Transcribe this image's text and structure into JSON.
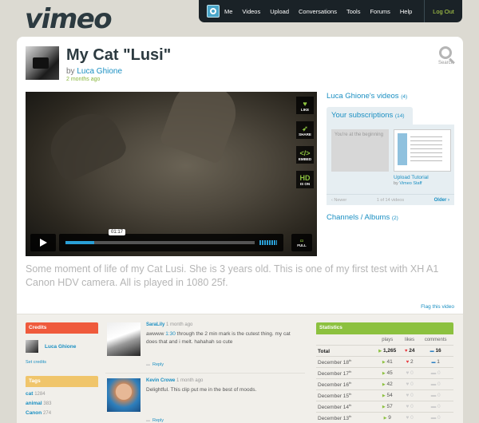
{
  "brand": "vimeo",
  "nav": {
    "items": [
      "Me",
      "Videos",
      "Upload",
      "Conversations",
      "Tools",
      "Forums",
      "Help"
    ],
    "logout": "Log Out"
  },
  "search": {
    "label": "Search"
  },
  "video": {
    "title": "My Cat \"Lusi\"",
    "by": "by",
    "author": "Luca Ghione",
    "posted": "2 months ago",
    "time": "01:17",
    "progress_fraction": 0.15,
    "buttons": {
      "like": "LIKE",
      "share": "SHARE",
      "embed": "EMBED",
      "hd": "HD",
      "hd_sub": "IS ON",
      "full": "FULL"
    },
    "description": "Some moment of life of my Cat Lusi. She is 3 years old. This is one of my first test with XH A1 Canon HDV camera. All is played in 1080 25f.",
    "flag": "Flag this video"
  },
  "sidebar": {
    "author_videos": "Luca Ghione's videos",
    "author_videos_count": "(4)",
    "subs": "Your subscriptions",
    "subs_count": "(14)",
    "sub_first": "You're at the beginning",
    "sub_title": "Upload Tutorial",
    "sub_by": "by",
    "sub_staff": "Vimeo Staff",
    "newer": "‹ Newer",
    "pager": "1 of 14 videos",
    "older": "Older ›",
    "channels": "Channels / Albums",
    "channels_count": "(2)"
  },
  "credits": {
    "header": "Credits",
    "name": "Luca Ghione",
    "set": "Set credits"
  },
  "tags": {
    "header": "Tags",
    "items": [
      {
        "name": "cat",
        "count": "1284"
      },
      {
        "name": "animal",
        "count": "383"
      },
      {
        "name": "Canon",
        "count": "274"
      }
    ]
  },
  "comments": [
    {
      "user": "SaraLily",
      "ago": "1 month ago",
      "text_a": "awwww ",
      "link": "1:30",
      "text_b": " through the 2 min mark is the cutest thing. my cat does that and i melt. hahahah so cute",
      "reply": "Reply"
    },
    {
      "user": "Kevin Crowe",
      "ago": "1 month ago",
      "text_a": "Delightful. This clip put me in the best of moods.",
      "link": "",
      "text_b": "",
      "reply": "Reply"
    }
  ],
  "stats": {
    "header": "Statistics",
    "cols": [
      "plays",
      "likes",
      "comments"
    ],
    "rows": [
      {
        "label": "Total",
        "sup": "",
        "plays": "1,265",
        "likes": "24",
        "comments": "16"
      },
      {
        "label": "December 18",
        "sup": "th",
        "plays": "41",
        "likes": "2",
        "comments": "1"
      },
      {
        "label": "December 17",
        "sup": "th",
        "plays": "45",
        "likes": "0",
        "comments": "0"
      },
      {
        "label": "December 16",
        "sup": "th",
        "plays": "42",
        "likes": "0",
        "comments": "0"
      },
      {
        "label": "December 15",
        "sup": "th",
        "plays": "54",
        "likes": "0",
        "comments": "0"
      },
      {
        "label": "December 14",
        "sup": "th",
        "plays": "57",
        "likes": "0",
        "comments": "0"
      },
      {
        "label": "December 13",
        "sup": "th",
        "plays": "9",
        "likes": "0",
        "comments": "0"
      }
    ]
  }
}
